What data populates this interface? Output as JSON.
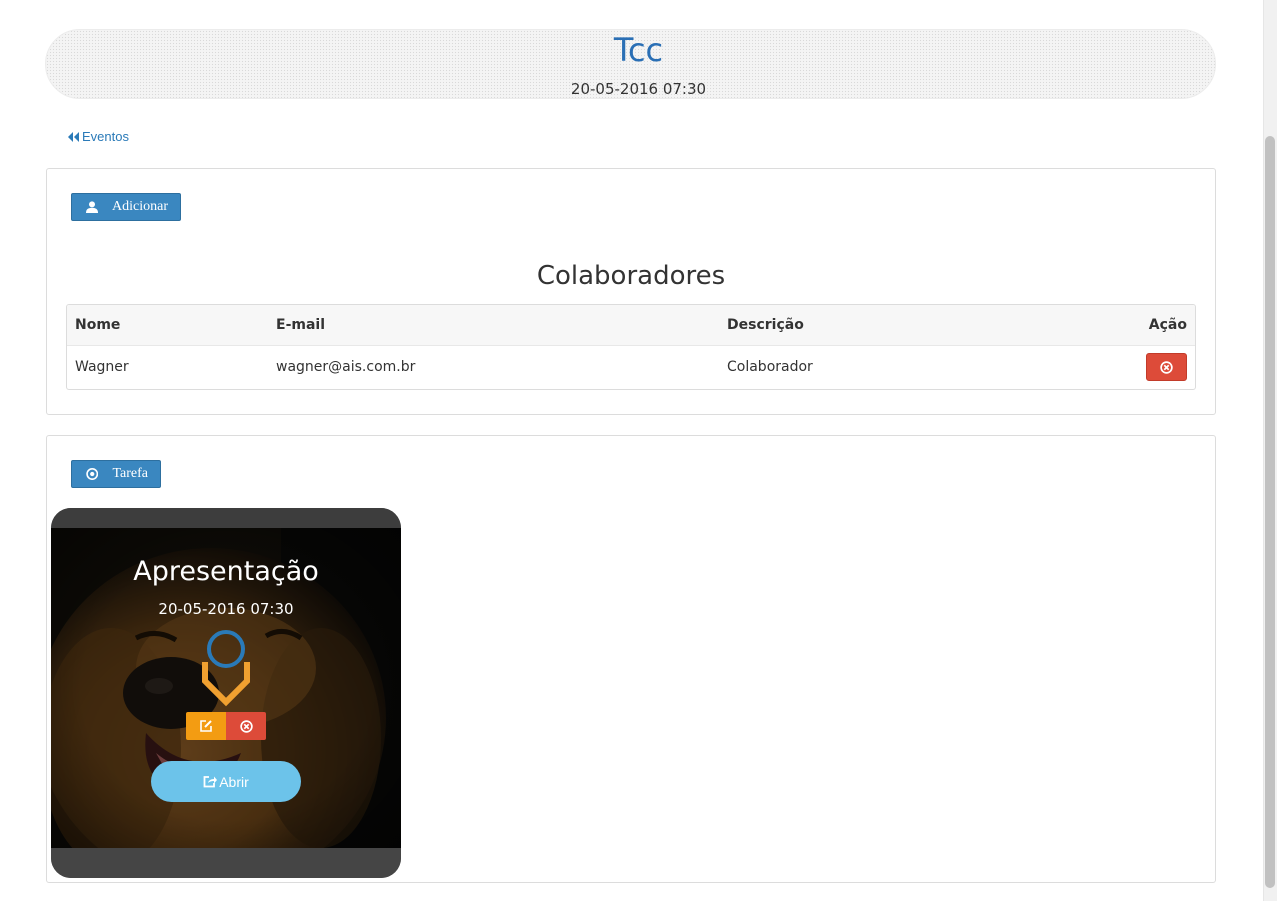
{
  "header": {
    "title": "Tcc",
    "datetime": "20-05-2016 07:30"
  },
  "nav": {
    "back_label": "Eventos",
    "back_icon": "double-chevron-left-icon"
  },
  "collaborators": {
    "add_label": "Adicionar",
    "add_icon": "user-icon",
    "title": "Colaboradores",
    "columns": [
      "Nome",
      "E-mail",
      "Descrição",
      "Ação"
    ],
    "rows": [
      {
        "nome": "Wagner",
        "email": "wagner@ais.com.br",
        "descricao": "Colaborador",
        "action_icon": "remove-circle-icon"
      }
    ]
  },
  "tasks": {
    "add_label": "Tarefa",
    "add_icon": "target-icon",
    "cards": [
      {
        "title": "Apresentação",
        "datetime": "20-05-2016 07:30",
        "image": "golden-retriever-photo",
        "status_icon": "pin-marker-icon",
        "edit_icon": "edit-icon",
        "remove_icon": "remove-circle-icon",
        "open_label": "Abrir",
        "open_icon": "share-icon"
      }
    ]
  },
  "colors": {
    "primary": "#3a87c0",
    "title_blue": "#2a6fb5",
    "danger": "#dd4b39",
    "warning": "#f39c12",
    "info": "#6cc3ea"
  }
}
